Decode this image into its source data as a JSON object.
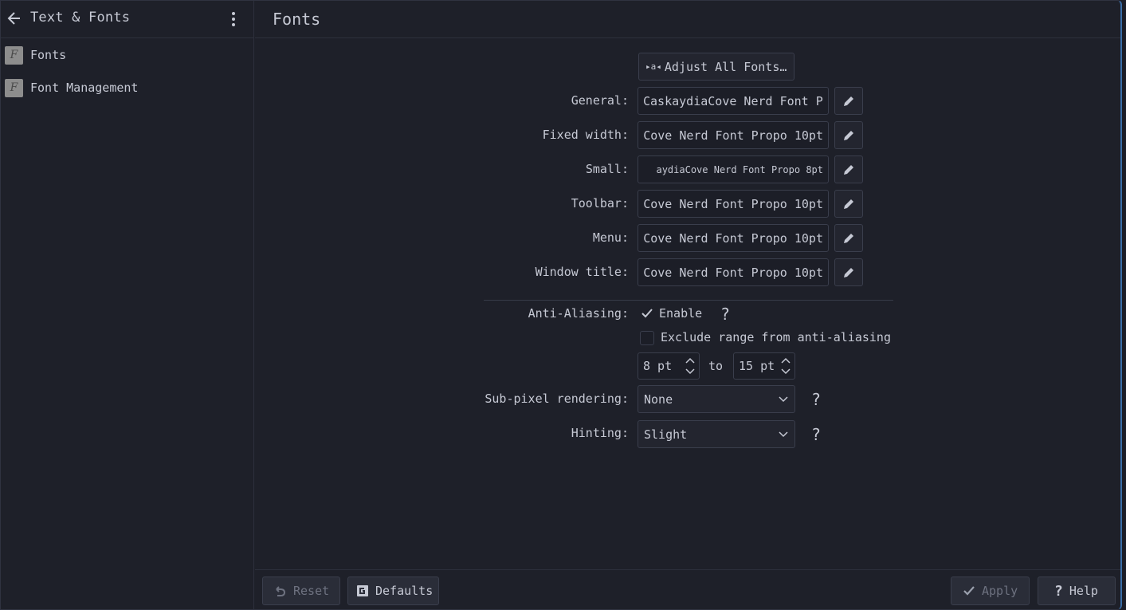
{
  "sidebar": {
    "title": "Text & Fonts",
    "items": [
      {
        "label": "Fonts"
      },
      {
        "label": "Font Management"
      }
    ]
  },
  "page": {
    "title": "Fonts",
    "adjust_all_label": "Adjust All Fonts…",
    "fonts": [
      {
        "label": "General:",
        "value": "CaskaydiaCove Nerd Font P"
      },
      {
        "label": "Fixed width:",
        "value": "Cove Nerd Font Propo 10pt"
      },
      {
        "label": "Small:",
        "value": "aydiaCove Nerd Font Propo 8pt"
      },
      {
        "label": "Toolbar:",
        "value": "Cove Nerd Font Propo 10pt"
      },
      {
        "label": "Menu:",
        "value": "Cove Nerd Font Propo 10pt"
      },
      {
        "label": "Window title:",
        "value": "Cove Nerd Font Propo 10pt"
      }
    ],
    "antialiasing": {
      "label": "Anti-Aliasing:",
      "enable_label": "Enable",
      "enable_checked": true,
      "exclude_label": "Exclude range from anti-aliasing",
      "exclude_checked": false,
      "range_from": "8 pt",
      "range_to_label": "to",
      "range_to": "15 pt"
    },
    "subpixel": {
      "label": "Sub-pixel rendering:",
      "value": "None"
    },
    "hinting": {
      "label": "Hinting:",
      "value": "Slight"
    },
    "help_mark": "?"
  },
  "footer": {
    "reset_label": "Reset",
    "defaults_label": "Defaults",
    "apply_label": "Apply",
    "help_label": "Help"
  },
  "icons": {
    "back": "arrow-left-icon",
    "menu": "kebab-menu-icon",
    "app": "fonts-app-icon",
    "edit": "pencil-icon",
    "check": "checkmark-icon"
  },
  "colors": {
    "background": "#1e2029",
    "border": "#3a3e4c",
    "text": "#c6c9d4",
    "accent_border": "#3a6ea8"
  }
}
